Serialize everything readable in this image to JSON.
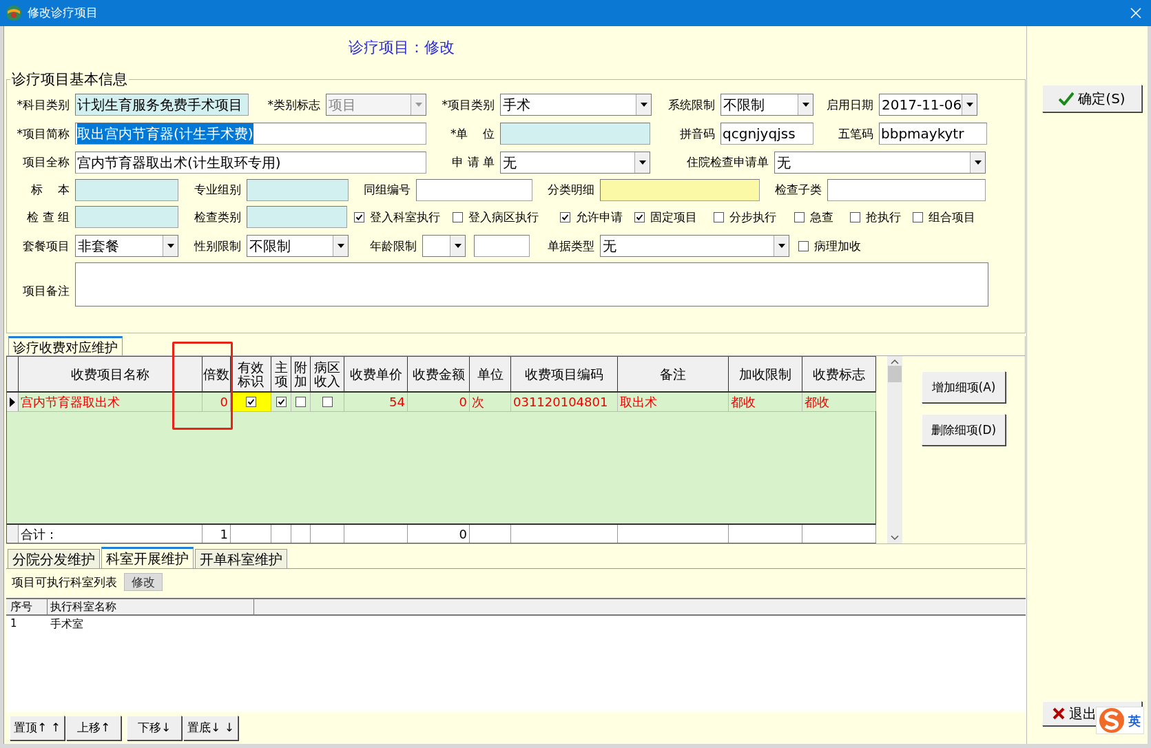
{
  "window": {
    "title": "修改诊疗项目"
  },
  "header": "诊疗项目：修改",
  "basic_info": {
    "title": "诊疗项目基本信息",
    "form_lines": [
      [
        {
          "kind": "label",
          "text": "*科目类别"
        },
        {
          "kind": "text",
          "value": "计划生育服务免费手术项目",
          "color": "#d2f0f0"
        },
        {
          "kind": "label",
          "text": "*类别标志"
        },
        {
          "kind": "combo",
          "value": "项目",
          "disabled": true
        },
        {
          "kind": "label",
          "text": "*项目类别"
        },
        {
          "kind": "combo",
          "value": "手术",
          "disabled": false
        },
        {
          "kind": "label",
          "text": "系统限制"
        },
        {
          "kind": "combo",
          "value": "不限制",
          "disabled": false
        },
        {
          "kind": "label",
          "text": "启用日期"
        },
        {
          "kind": "combo",
          "value": "2017-11-06",
          "disabled": false
        }
      ],
      [
        {
          "kind": "label",
          "text": "*项目简称"
        },
        {
          "kind": "text",
          "value": "取出宫内节育器(计生手术费)",
          "color": "#ffffff",
          "text_selected": true
        },
        {
          "kind": "label",
          "text": "*单    位"
        },
        {
          "kind": "text",
          "color": "#d2f0f0"
        },
        {
          "kind": "label",
          "text": "拼音码"
        },
        {
          "kind": "text",
          "value": "qcgnjyqjss",
          "color": "#ffffff"
        },
        {
          "kind": "label",
          "text": "五笔码"
        },
        {
          "kind": "text",
          "value": "bbpmaykytr",
          "color": "#ffffff"
        }
      ],
      [
        {
          "kind": "label",
          "text": "项目全称"
        },
        {
          "kind": "text",
          "value": "宫内节育器取出术(计生取环专用)",
          "color": "#ffffff"
        },
        {
          "kind": "label",
          "text": "申 请 单"
        },
        {
          "kind": "combo",
          "value": "无",
          "disabled": false
        },
        {
          "kind": "label",
          "text": "住院检查申请单"
        },
        {
          "kind": "combo",
          "value": "无",
          "disabled": false
        }
      ],
      [
        {
          "kind": "label",
          "text": "标    本"
        },
        {
          "kind": "text",
          "color": "#d2f0f0"
        },
        {
          "kind": "label",
          "text": "专业组别"
        },
        {
          "kind": "text",
          "color": "#d2f0f0"
        },
        {
          "kind": "label",
          "text": "同组编号"
        },
        {
          "kind": "text",
          "color": "#ffffff"
        },
        {
          "kind": "label",
          "text": "分类明细"
        },
        {
          "kind": "text",
          "color": "#fbf9a6"
        },
        {
          "kind": "label",
          "text": "检查子类"
        },
        {
          "kind": "text",
          "color": "#ffffff"
        }
      ],
      [
        {
          "kind": "label",
          "text": "检 查 组"
        },
        {
          "kind": "text",
          "color": "#d2f0f0"
        },
        {
          "kind": "label",
          "text": "检查类别"
        },
        {
          "kind": "text",
          "color": "#d2f0f0"
        },
        {
          "kind": "checkbox",
          "label": "登入科室执行",
          "checked": true
        },
        {
          "kind": "checkbox",
          "label": "登入病区执行",
          "checked": false
        },
        {
          "kind": "checkbox",
          "label": "允许申请",
          "checked": true
        },
        {
          "kind": "checkbox",
          "label": "固定项目",
          "checked": true
        },
        {
          "kind": "checkbox",
          "label": "分步执行",
          "checked": false
        },
        {
          "kind": "checkbox",
          "label": "急查",
          "checked": false
        },
        {
          "kind": "checkbox",
          "label": "抢执行",
          "checked": false
        },
        {
          "kind": "checkbox",
          "label": "组合项目",
          "checked": false
        }
      ],
      [
        {
          "kind": "label",
          "text": "套餐项目"
        },
        {
          "kind": "combo",
          "value": "非套餐",
          "disabled": false
        },
        {
          "kind": "label",
          "text": "性别限制"
        },
        {
          "kind": "combo",
          "value": "不限制",
          "disabled": false
        },
        {
          "kind": "label",
          "text": "年龄限制"
        },
        {
          "kind": "combo",
          "disabled": false
        },
        {
          "kind": "text",
          "color": "#ffffff"
        },
        {
          "kind": "label",
          "text": "单据类型"
        },
        {
          "kind": "combo",
          "value": "无",
          "disabled": false
        },
        {
          "kind": "checkbox",
          "label": "病理加收",
          "checked": false
        }
      ],
      [
        {
          "kind": "label",
          "text": "项目备注"
        },
        {
          "kind": "textarea",
          "color": "#ffffff"
        }
      ]
    ]
  },
  "confirm_button": "确定(S)",
  "charge_section": {
    "tab": "诊疗收费对应维护",
    "columns": [
      "收费项目名称",
      "倍数",
      "有效标识",
      "主项",
      "附加",
      "病区收入",
      "收费单价",
      "收费金额",
      "单位",
      "收费项目编码",
      "备注",
      "加收限制",
      "收费标志"
    ],
    "rows": [
      {
        "selected": true,
        "cells": [
          {
            "text": "宫内节育器取出术"
          },
          {
            "text": "0"
          },
          {
            "checked": true,
            "focused": true
          },
          {
            "checked": true,
            "focused": false
          },
          {
            "checked": false,
            "focused": false
          },
          {
            "checked": false,
            "focused": false
          },
          {
            "text": "54"
          },
          {
            "text": "0"
          },
          {
            "text": "次"
          },
          {
            "text": "031120104801"
          },
          {
            "text": "取出术"
          },
          {
            "text": "都收"
          },
          {
            "text": "都收"
          }
        ]
      }
    ],
    "totals": {
      "label": "合计：",
      "multiple": "1",
      "amount": "0"
    },
    "buttons": [
      "增加细项(A)",
      "删除细项(D)"
    ]
  },
  "bottom_tabs": [
    {
      "label": "分院分发维护",
      "selected": false
    },
    {
      "label": "科室开展维护",
      "selected": true
    },
    {
      "label": "开单科室维护",
      "selected": false
    }
  ],
  "dept_list": {
    "title": "项目可执行科室列表",
    "edit_button": "修改",
    "columns": [
      "序号",
      "执行科室名称"
    ],
    "rows": [
      [
        "1",
        "手术室"
      ]
    ]
  },
  "move_buttons": [
    "置顶↑ ↑",
    "上移↑",
    "下移↓",
    "置底↓ ↓"
  ],
  "exit_button": "退出",
  "ime_indicator": {
    "mode": "英"
  }
}
